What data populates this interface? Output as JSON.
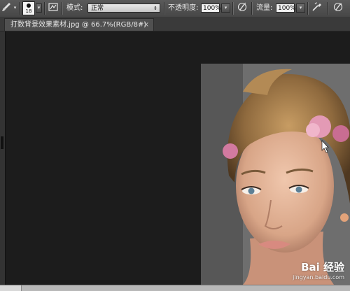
{
  "options": {
    "brush_size": "18",
    "mode_label": "模式:",
    "mode_value": "正常",
    "opacity_label": "不透明度:",
    "opacity_value": "100%",
    "flow_label": "流量:",
    "flow_value": "100%"
  },
  "document": {
    "tab_title": "打数背景效果素材.jpg @ 66.7%(RGB/8#)",
    "close_glyph": "×"
  },
  "watermark": {
    "brand": "Bai 经验",
    "url": "jingyan.baidu.com"
  },
  "icons": {
    "brush_tool": "brush-icon",
    "brush_preset": "brush-preset-icon",
    "brush_panel": "brush-panel-toggle-icon",
    "opacity_pressure": "pressure-opacity-icon",
    "airbrush": "airbrush-icon",
    "size_pressure": "pressure-size-icon"
  }
}
